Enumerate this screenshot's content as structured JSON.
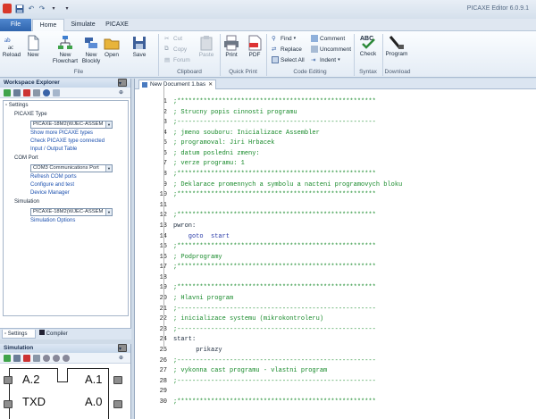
{
  "app": {
    "title": "PICAXE Editor 6.0.9.1"
  },
  "menu": {
    "file": "File",
    "home": "Home",
    "simulate": "Simulate",
    "picaxe": "PICAXE"
  },
  "ribbon": {
    "reload": "Reload",
    "new": "New",
    "new_flowchart": "New Flowchart",
    "new_blockly": "New Blockly",
    "open": "Open",
    "save": "Save",
    "cut": "Cut",
    "copy": "Copy",
    "forum": "Forum",
    "paste": "Paste",
    "print": "Print",
    "pdf": "PDF",
    "find": "Find",
    "replace": "Replace",
    "select_all": "Select All",
    "comment": "Comment",
    "uncomment": "Uncomment",
    "indent": "Indent",
    "check": "Check",
    "program": "Program",
    "groups": {
      "file": "File",
      "clipboard": "Clipboard",
      "quick_print": "Quick Print",
      "code_editing": "Code Editing",
      "syntax": "Syntax",
      "download": "Download"
    }
  },
  "workspace": {
    "title": "Workspace Explorer",
    "settings": "Settings",
    "picaxe_type": "PICAXE Type",
    "picaxe_value": "PICAXE-18M2(WJEC-ASSEM",
    "show_more": "Show more PICAXE types",
    "check_connected": "Check PICAXE type connected",
    "io_table": "Input / Output Table",
    "com_port": "COM Port",
    "com_value": "COM3 Communications Port",
    "refresh": "Refresh COM ports",
    "configure": "Configure and test",
    "device_manager": "Device Manager",
    "simulation": "Simulation",
    "sim_value": "PICAXE-18M2(WJEC-ASSEM",
    "sim_options": "Simulation Options",
    "tab_settings": "Settings",
    "tab_compiler": "Compiler"
  },
  "simulation": {
    "title": "Simulation",
    "pins": {
      "a2": "A.2",
      "a1": "A.1",
      "txd": "TXD",
      "a0": "A.0"
    }
  },
  "editor": {
    "tab": "New Document 1.bas",
    "lines": [
      {
        "n": "1",
        "t": ";*****************************************************",
        "c": "cm"
      },
      {
        "n": "2",
        "t": "; Strucny popis cinnosti programu",
        "c": "cm"
      },
      {
        "n": "3",
        "t": ";-----------------------------------------------------",
        "c": "cm"
      },
      {
        "n": "4",
        "t": "; jmeno souboru: Inicializace Assembler",
        "c": "cm"
      },
      {
        "n": "5",
        "t": "; programoval: Jiri Hrbacek",
        "c": "cm"
      },
      {
        "n": "6",
        "t": "; datum posledni zmeny:",
        "c": "cm"
      },
      {
        "n": "7",
        "t": "; verze programu: 1",
        "c": "cm"
      },
      {
        "n": "8",
        "t": ";*****************************************************",
        "c": "cm"
      },
      {
        "n": "9",
        "t": "; Deklarace promennych a symbolu a nacteni programovych bloku",
        "c": "cm"
      },
      {
        "n": "10",
        "t": ";*****************************************************",
        "c": "cm"
      },
      {
        "n": "11",
        "t": "",
        "c": "kw"
      },
      {
        "n": "12",
        "t": ";*****************************************************",
        "c": "cm"
      },
      {
        "n": "13",
        "t": "pwron:",
        "c": "kw"
      },
      {
        "n": "14",
        "t": "    goto  start",
        "c": "go"
      },
      {
        "n": "15",
        "t": ";*****************************************************",
        "c": "cm"
      },
      {
        "n": "16",
        "t": "; Podprogramy",
        "c": "cm"
      },
      {
        "n": "17",
        "t": ";*****************************************************",
        "c": "cm"
      },
      {
        "n": "18",
        "t": "",
        "c": "kw"
      },
      {
        "n": "19",
        "t": ";*****************************************************",
        "c": "cm"
      },
      {
        "n": "20",
        "t": "; Hlavni program",
        "c": "cm"
      },
      {
        "n": "21",
        "t": ";-----------------------------------------------------",
        "c": "cm"
      },
      {
        "n": "22",
        "t": "; inicializace systemu (mikrokontroleru)",
        "c": "cm"
      },
      {
        "n": "23",
        "t": ";-----------------------------------------------------",
        "c": "cm"
      },
      {
        "n": "24",
        "t": "start:",
        "c": "kw"
      },
      {
        "n": "25",
        "t": "      prikazy",
        "c": "kw"
      },
      {
        "n": "26",
        "t": ";-----------------------------------------------------",
        "c": "cm"
      },
      {
        "n": "27",
        "t": "; vykonna cast programu - vlastni program",
        "c": "cm"
      },
      {
        "n": "28",
        "t": ";-----------------------------------------------------",
        "c": "cm"
      },
      {
        "n": "29",
        "t": "",
        "c": "kw"
      },
      {
        "n": "30",
        "t": ";*****************************************************",
        "c": "cm"
      }
    ]
  }
}
